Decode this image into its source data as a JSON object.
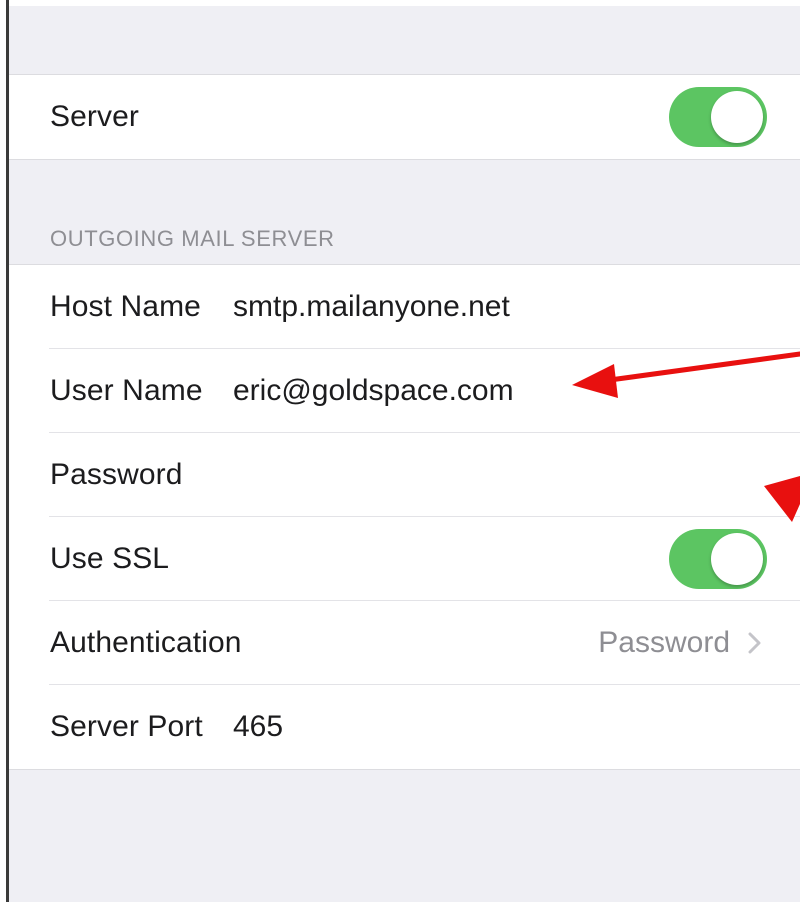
{
  "server_section": {
    "server_label": "Server",
    "server_toggle_on": true
  },
  "outgoing_section": {
    "header": "OUTGOING MAIL SERVER",
    "host_name_label": "Host Name",
    "host_name_value": "smtp.mailanyone.net",
    "user_name_label": "User Name",
    "user_name_value": "eric@goldspace.com",
    "password_label": "Password",
    "password_value": "",
    "use_ssl_label": "Use SSL",
    "use_ssl_on": true,
    "authentication_label": "Authentication",
    "authentication_value": "Password",
    "server_port_label": "Server Port",
    "server_port_value": "465"
  },
  "icons": {
    "chevron": "chevron-right-icon",
    "annotation_arrow": "red-arrow"
  },
  "colors": {
    "toggle_on": "#5cc562",
    "background": "#efeff4",
    "secondary_text": "#8e8e93",
    "annotation_arrow": "#e8100f"
  }
}
